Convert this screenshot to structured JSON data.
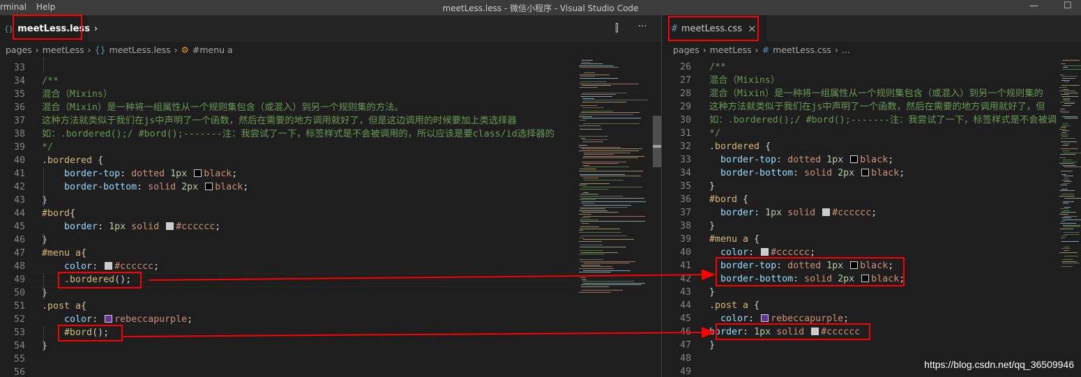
{
  "titlebar": {
    "menus": [
      "rminal",
      "Help"
    ],
    "title": "meetLess.less - 微信小程序 - Visual Studio Code",
    "win_min": "—",
    "win_max": "☐"
  },
  "left": {
    "tab": {
      "icon": "{}",
      "label": "meetLess.less",
      "suffix": "›"
    },
    "breadcrumb": {
      "p1": "pages",
      "p2": "meetLess",
      "icon": "{}",
      "p3": "meetLess.less",
      "icon2": "⚙",
      "p4": "#menu a"
    },
    "split_icon": "⫿",
    "more_icon": "···"
  },
  "right": {
    "tab": {
      "icon": "#",
      "label": "meetLess.css",
      "close": "×"
    },
    "breadcrumb": {
      "p1": "pages",
      "p2": "meetLess",
      "icon": "#",
      "p3": "meetLess.css",
      "p4": "..."
    }
  },
  "left_lines": [
    {
      "n": "33",
      "t": []
    },
    {
      "n": "34",
      "t": [
        [
          "c-comment",
          "/**"
        ]
      ]
    },
    {
      "n": "35",
      "t": [
        [
          "c-comment",
          "混合（Mixins）"
        ]
      ]
    },
    {
      "n": "36",
      "t": [
        [
          "c-comment",
          "混合（Mixin）是一种将一组属性从一个规则集包含（或混入）到另一个规则集的方法。"
        ]
      ]
    },
    {
      "n": "37",
      "t": [
        [
          "c-comment",
          "这种方法就类似于我们在js中声明了一个函数，然后在需要的地方调用就好了，但是这边调用的时候要加上类选择器"
        ]
      ]
    },
    {
      "n": "38",
      "t": [
        [
          "c-comment",
          "如：.bordered();/ #bord();-------注：我尝试了一下，标签样式是不会被调用的，所以应该是要class/id选择器的"
        ]
      ]
    },
    {
      "n": "39",
      "t": [
        [
          "c-comment",
          "*/"
        ]
      ]
    },
    {
      "n": "40",
      "t": [
        [
          "c-sel",
          ".bordered"
        ],
        [
          "c-punc",
          " {"
        ]
      ]
    },
    {
      "n": "41",
      "t": [
        [
          "c-punc",
          "    "
        ],
        [
          "c-prop",
          "border-top"
        ],
        [
          "c-punc",
          ": "
        ],
        [
          "c-val",
          "dotted "
        ],
        [
          "c-num",
          "1px "
        ],
        [
          "sw",
          "#000000"
        ],
        [
          "c-val",
          "black"
        ],
        [
          "c-punc",
          ";"
        ]
      ]
    },
    {
      "n": "42",
      "t": [
        [
          "c-punc",
          "    "
        ],
        [
          "c-prop",
          "border-bottom"
        ],
        [
          "c-punc",
          ": "
        ],
        [
          "c-val",
          "solid "
        ],
        [
          "c-num",
          "2px "
        ],
        [
          "sw",
          "#000000"
        ],
        [
          "c-val",
          "black"
        ],
        [
          "c-punc",
          ";"
        ]
      ]
    },
    {
      "n": "43",
      "t": [
        [
          "c-punc",
          "}"
        ]
      ]
    },
    {
      "n": "44",
      "t": [
        [
          "c-sel",
          "#bord"
        ],
        [
          "c-punc",
          "{"
        ]
      ]
    },
    {
      "n": "45",
      "t": [
        [
          "c-punc",
          "    "
        ],
        [
          "c-prop",
          "border"
        ],
        [
          "c-punc",
          ": "
        ],
        [
          "c-num",
          "1px "
        ],
        [
          "c-val",
          "solid "
        ],
        [
          "sw",
          "#cccccc"
        ],
        [
          "c-val",
          "#cccccc"
        ],
        [
          "c-punc",
          ";"
        ]
      ]
    },
    {
      "n": "46",
      "t": [
        [
          "c-punc",
          "}"
        ]
      ]
    },
    {
      "n": "47",
      "t": [
        [
          "c-sel",
          "#menu a"
        ],
        [
          "c-punc",
          "{"
        ]
      ]
    },
    {
      "n": "48",
      "t": [
        [
          "c-punc",
          "    "
        ],
        [
          "c-prop",
          "color"
        ],
        [
          "c-punc",
          ": "
        ],
        [
          "sw",
          "#cccccc"
        ],
        [
          "c-val",
          "#cccccc"
        ],
        [
          "c-punc",
          ";"
        ]
      ]
    },
    {
      "n": "49",
      "t": [
        [
          "c-punc",
          "    "
        ],
        [
          "c-sel",
          ".bordered"
        ],
        [
          "c-punc",
          "();"
        ]
      ]
    },
    {
      "n": "50",
      "t": [
        [
          "c-punc",
          "}"
        ]
      ]
    },
    {
      "n": "51",
      "t": [
        [
          "c-sel",
          ".post a"
        ],
        [
          "c-punc",
          "{"
        ]
      ]
    },
    {
      "n": "52",
      "t": [
        [
          "c-punc",
          "    "
        ],
        [
          "c-prop",
          "color"
        ],
        [
          "c-punc",
          ": "
        ],
        [
          "sw",
          "#663399"
        ],
        [
          "c-val",
          "rebeccapurple"
        ],
        [
          "c-punc",
          ";"
        ]
      ]
    },
    {
      "n": "53",
      "t": [
        [
          "c-punc",
          "    "
        ],
        [
          "c-sel",
          "#bord"
        ],
        [
          "c-punc",
          "();"
        ]
      ]
    },
    {
      "n": "54",
      "t": [
        [
          "c-punc",
          "}"
        ]
      ]
    },
    {
      "n": "55",
      "t": []
    },
    {
      "n": "56",
      "t": []
    }
  ],
  "right_lines": [
    {
      "n": "26",
      "t": [
        [
          "c-comment",
          "/**"
        ]
      ]
    },
    {
      "n": "27",
      "t": [
        [
          "c-comment",
          "混合（Mixins）"
        ]
      ]
    },
    {
      "n": "28",
      "t": [
        [
          "c-comment",
          "混合（Mixin）是一种将一组属性从一个规则集包含（或混入）到另一个规则集的"
        ]
      ]
    },
    {
      "n": "29",
      "t": [
        [
          "c-comment",
          "这种方法就类似于我们在js中声明了一个函数，然后在需要的地方调用就好了，但"
        ]
      ]
    },
    {
      "n": "30",
      "t": [
        [
          "c-comment",
          "如：.bordered();/ #bord();-------注：我尝试了一下，标签样式是不会被调"
        ]
      ]
    },
    {
      "n": "31",
      "t": [
        [
          "c-comment",
          "*/"
        ]
      ]
    },
    {
      "n": "32",
      "t": [
        [
          "c-sel",
          ".bordered"
        ],
        [
          "c-punc",
          " {"
        ]
      ]
    },
    {
      "n": "33",
      "t": [
        [
          "c-punc",
          "  "
        ],
        [
          "c-prop",
          "border-top"
        ],
        [
          "c-punc",
          ": "
        ],
        [
          "c-val",
          "dotted "
        ],
        [
          "c-num",
          "1px "
        ],
        [
          "sw",
          "#000000"
        ],
        [
          "c-val",
          "black"
        ],
        [
          "c-punc",
          ";"
        ]
      ]
    },
    {
      "n": "34",
      "t": [
        [
          "c-punc",
          "  "
        ],
        [
          "c-prop",
          "border-bottom"
        ],
        [
          "c-punc",
          ": "
        ],
        [
          "c-val",
          "solid "
        ],
        [
          "c-num",
          "2px "
        ],
        [
          "sw",
          "#000000"
        ],
        [
          "c-val",
          "black"
        ],
        [
          "c-punc",
          ";"
        ]
      ]
    },
    {
      "n": "35",
      "t": [
        [
          "c-punc",
          "}"
        ]
      ]
    },
    {
      "n": "36",
      "t": [
        [
          "c-sel",
          "#bord"
        ],
        [
          "c-punc",
          " {"
        ]
      ]
    },
    {
      "n": "37",
      "t": [
        [
          "c-punc",
          "  "
        ],
        [
          "c-prop",
          "border"
        ],
        [
          "c-punc",
          ": "
        ],
        [
          "c-num",
          "1px "
        ],
        [
          "c-val",
          "solid "
        ],
        [
          "sw",
          "#cccccc"
        ],
        [
          "c-val",
          "#cccccc"
        ],
        [
          "c-punc",
          ";"
        ]
      ]
    },
    {
      "n": "38",
      "t": [
        [
          "c-punc",
          "}"
        ]
      ]
    },
    {
      "n": "39",
      "t": [
        [
          "c-sel",
          "#menu a"
        ],
        [
          "c-punc",
          " {"
        ]
      ]
    },
    {
      "n": "40",
      "t": [
        [
          "c-punc",
          "  "
        ],
        [
          "c-prop",
          "color"
        ],
        [
          "c-punc",
          ": "
        ],
        [
          "sw",
          "#cccccc"
        ],
        [
          "c-val",
          "#cccccc"
        ],
        [
          "c-punc",
          ";"
        ]
      ]
    },
    {
      "n": "41",
      "t": [
        [
          "c-punc",
          "  "
        ],
        [
          "c-prop",
          "border-top"
        ],
        [
          "c-punc",
          ": "
        ],
        [
          "c-val",
          "dotted "
        ],
        [
          "c-num",
          "1px "
        ],
        [
          "sw",
          "#000000"
        ],
        [
          "c-val",
          "black"
        ],
        [
          "c-punc",
          ";"
        ]
      ]
    },
    {
      "n": "42",
      "t": [
        [
          "c-punc",
          "  "
        ],
        [
          "c-prop",
          "border-bottom"
        ],
        [
          "c-punc",
          ": "
        ],
        [
          "c-val",
          "solid "
        ],
        [
          "c-num",
          "2px "
        ],
        [
          "sw",
          "#000000"
        ],
        [
          "c-val",
          "black"
        ],
        [
          "c-punc",
          ";"
        ]
      ]
    },
    {
      "n": "43",
      "t": [
        [
          "c-punc",
          "}"
        ]
      ]
    },
    {
      "n": "44",
      "t": [
        [
          "c-sel",
          ".post a"
        ],
        [
          "c-punc",
          " {"
        ]
      ]
    },
    {
      "n": "45",
      "t": [
        [
          "c-punc",
          "  "
        ],
        [
          "c-prop",
          "color"
        ],
        [
          "c-punc",
          ": "
        ],
        [
          "sw",
          "#663399"
        ],
        [
          "c-val",
          "rebeccapurple"
        ],
        [
          "c-punc",
          ";"
        ]
      ]
    },
    {
      "n": "46",
      "t": [
        [
          "c-prop",
          "border"
        ],
        [
          "c-punc",
          ": "
        ],
        [
          "c-num",
          "1px "
        ],
        [
          "c-val",
          "solid "
        ],
        [
          "sw",
          "#cccccc"
        ],
        [
          "c-val",
          "#cccccc"
        ]
      ]
    },
    {
      "n": "47",
      "t": [
        [
          "c-punc",
          "}"
        ]
      ]
    },
    {
      "n": "48",
      "t": []
    },
    {
      "n": "49",
      "t": []
    }
  ],
  "watermark": "https://blog.csdn.net/qq_36509946",
  "colors": {
    "annotation": "#ff0000",
    "editor_bg": "#1e1e1e",
    "comment": "#6a9955"
  }
}
